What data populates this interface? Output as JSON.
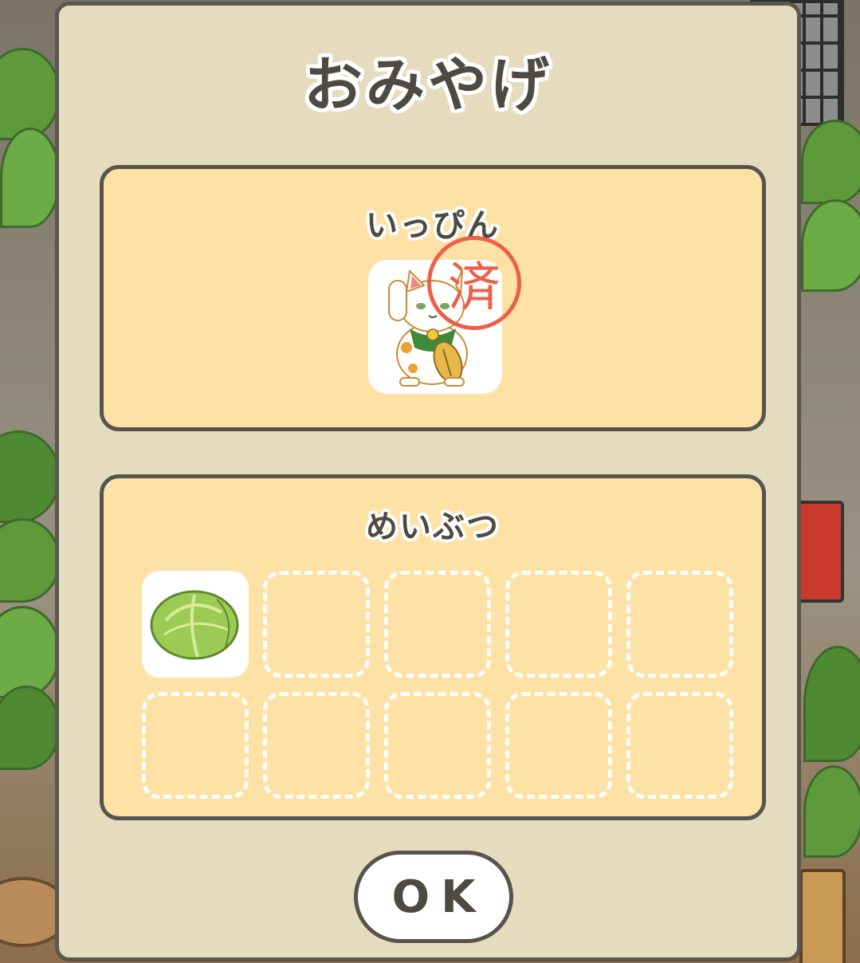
{
  "dialog": {
    "title": "おみやげ",
    "specialty": {
      "heading": "いっぴん",
      "item_icon": "maneki-neko-icon",
      "stamp_text": "済"
    },
    "souvenirs": {
      "heading": "めいぶつ",
      "slots": [
        {
          "icon": "cabbage-icon",
          "filled": true
        },
        {
          "filled": false
        },
        {
          "filled": false
        },
        {
          "filled": false
        },
        {
          "filled": false
        },
        {
          "filled": false
        },
        {
          "filled": false
        },
        {
          "filled": false
        },
        {
          "filled": false
        },
        {
          "filled": false
        }
      ]
    },
    "ok_label": "OK"
  },
  "colors": {
    "dialog_bg": "#e5dcc0",
    "panel_bg": "#fee1a4",
    "border": "#56544c",
    "stamp": "#ee5f4a"
  }
}
